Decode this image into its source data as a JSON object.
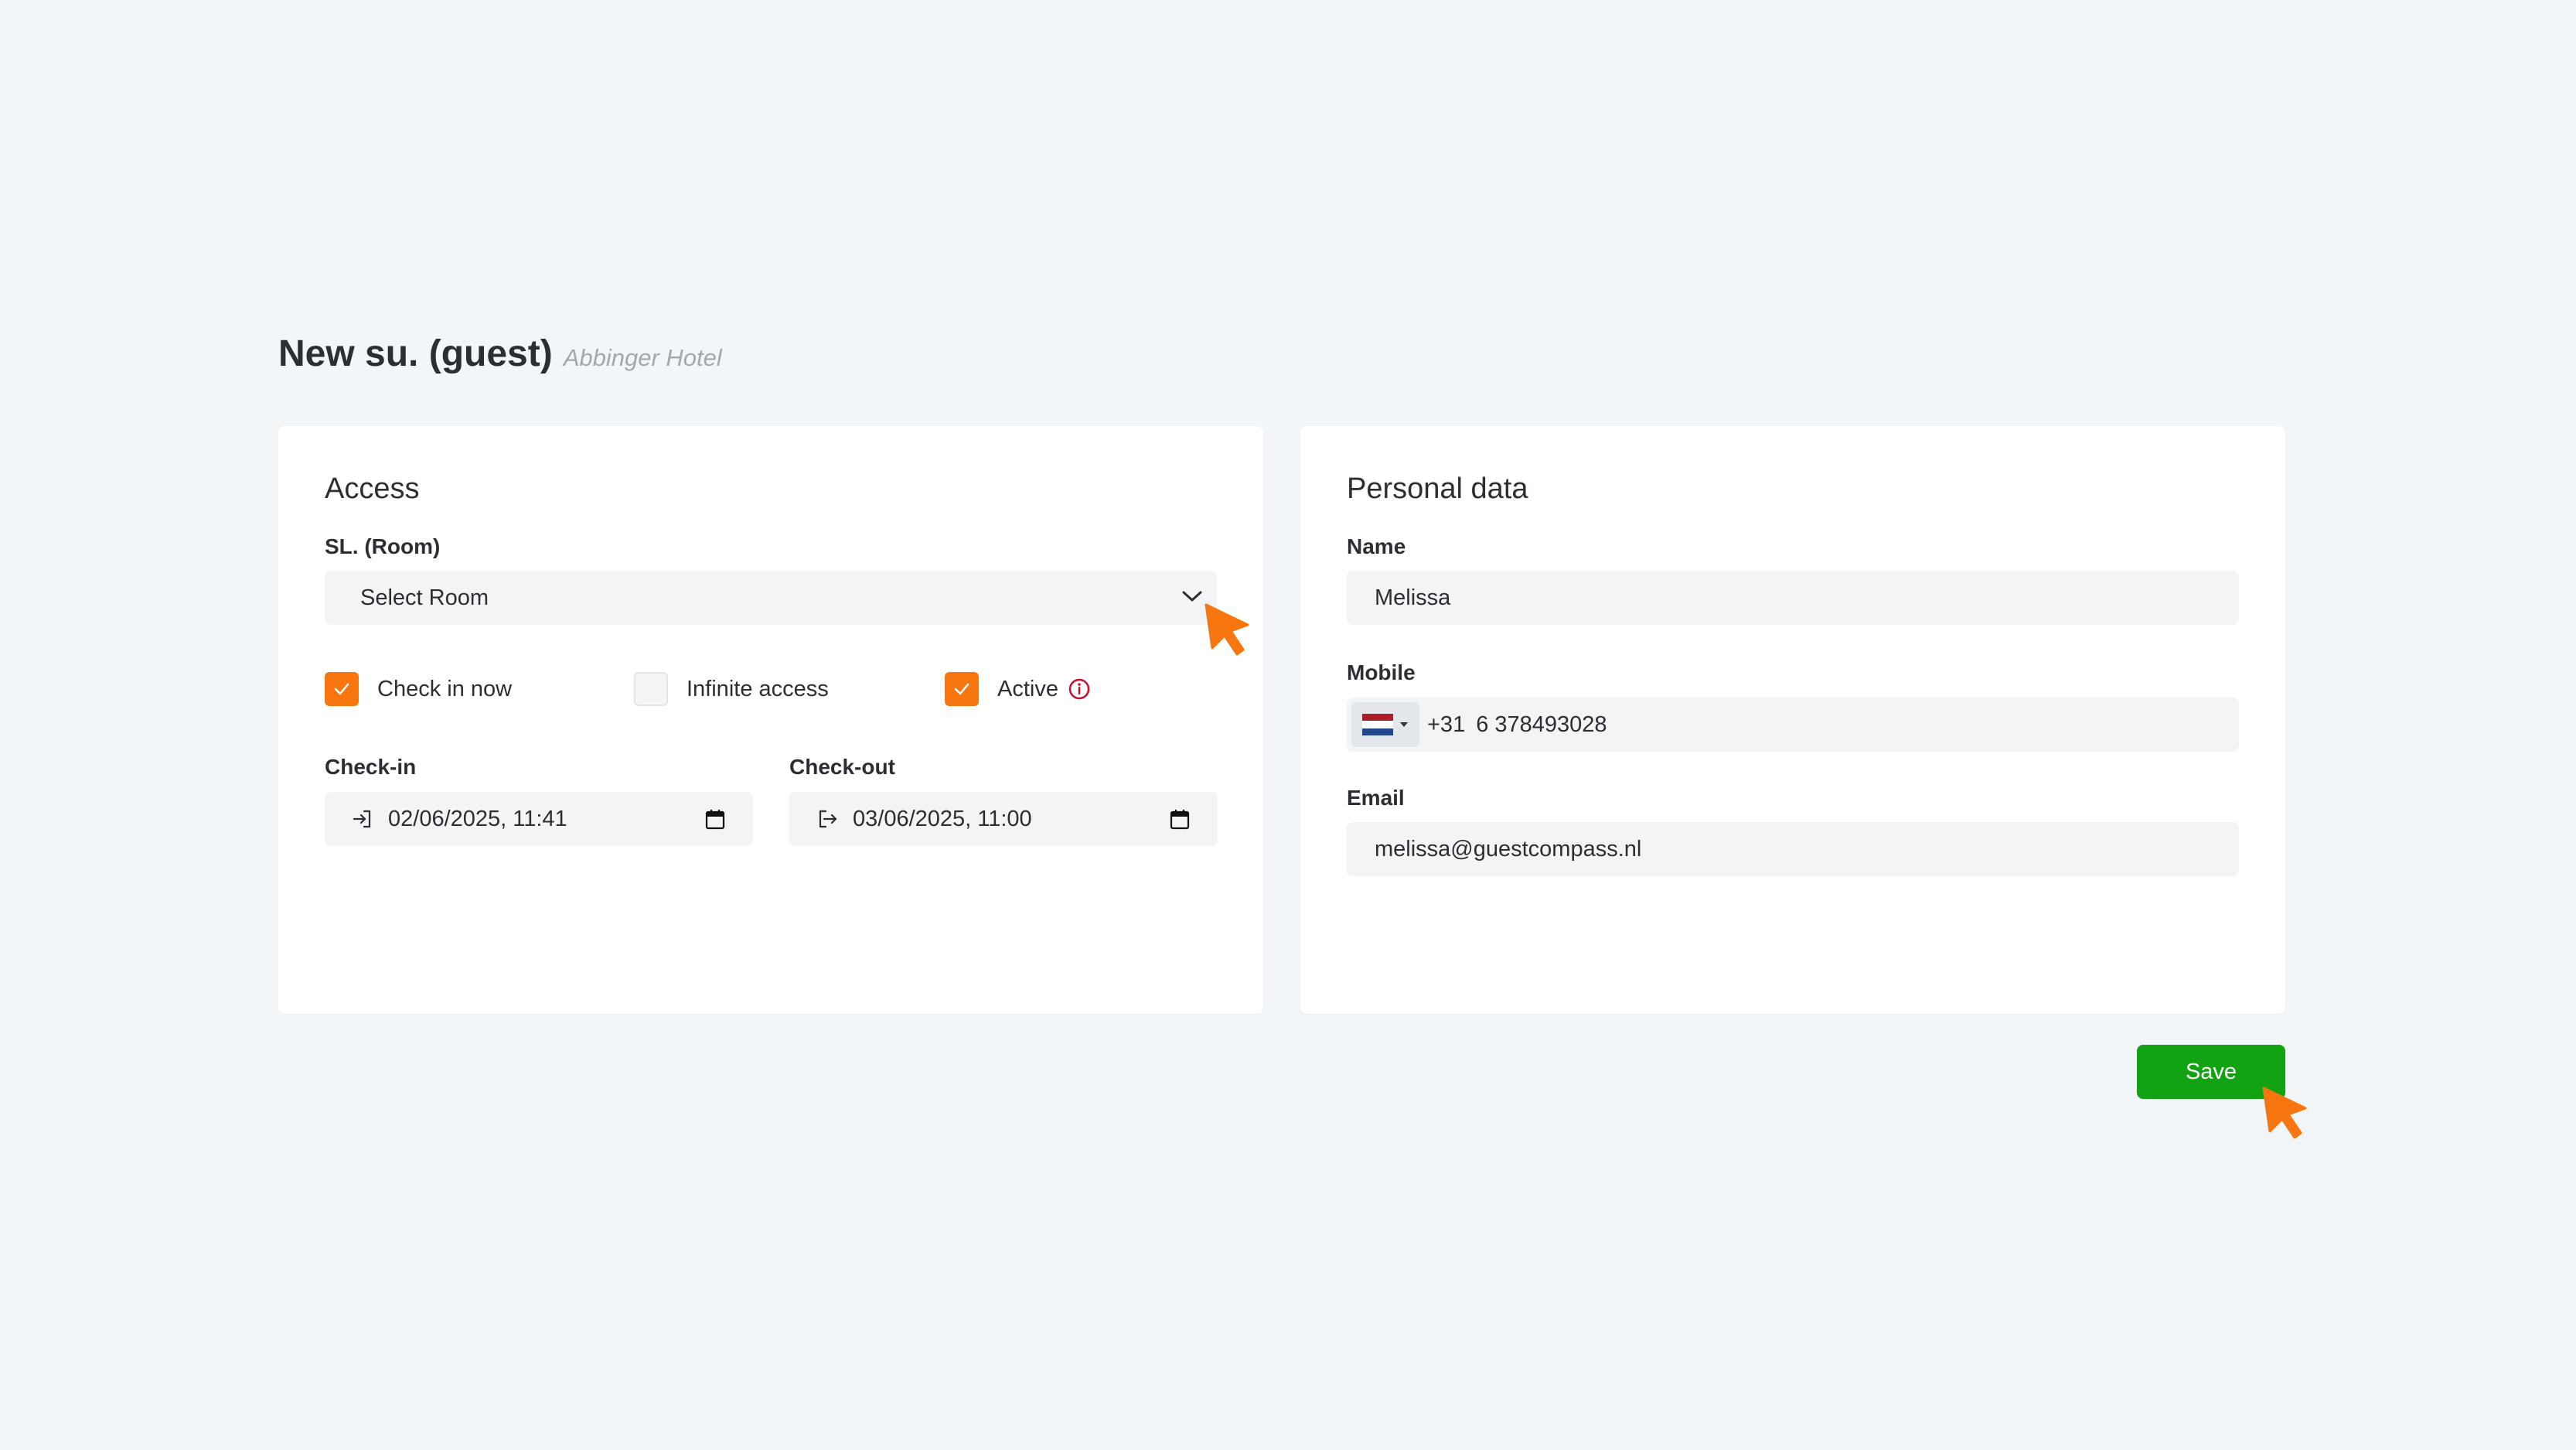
{
  "page": {
    "title": "New su. (guest)",
    "subtitle": "Abbinger Hotel"
  },
  "access": {
    "title": "Access",
    "room_label": "SL. (Room)",
    "room_placeholder": "Select Room",
    "checkboxes": [
      {
        "label": "Check in now",
        "checked": true
      },
      {
        "label": "Infinite access",
        "checked": false
      },
      {
        "label": "Active",
        "checked": true
      }
    ],
    "checkin_label": "Check-in",
    "checkin_value": "02/06/2025, 11:41",
    "checkout_label": "Check-out",
    "checkout_value": "03/06/2025, 11:00"
  },
  "personal": {
    "title": "Personal data",
    "name_label": "Name",
    "name_value": "Melissa",
    "mobile_label": "Mobile",
    "mobile_code": "+31",
    "mobile_value": "6 378493028",
    "email_label": "Email",
    "email_value": "melissa@guestcompass.nl"
  },
  "actions": {
    "save_label": "Save"
  },
  "colors": {
    "accent": "#f7760f",
    "save": "#12a312",
    "info": "#c8102e"
  },
  "icons": {
    "chevron": "chevron-down-icon",
    "checkin": "sign-in-icon",
    "checkout": "sign-out-icon",
    "calendar": "calendar-icon",
    "info": "info-icon",
    "flag": "netherlands-flag-icon",
    "cursor": "cursor-arrow-icon"
  }
}
